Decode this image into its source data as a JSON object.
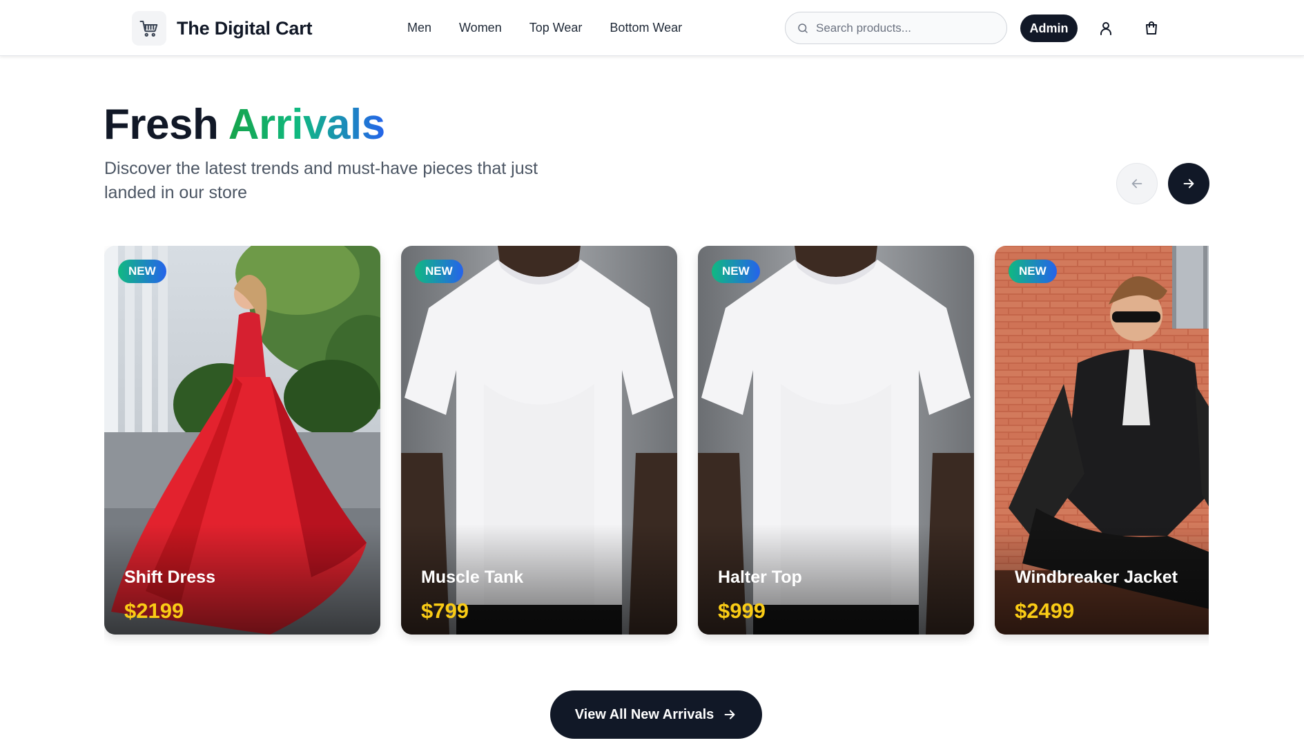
{
  "header": {
    "brand": "The Digital Cart",
    "brand_icon": "shopping-cart-icon",
    "nav": [
      "Men",
      "Women",
      "Top Wear",
      "Bottom Wear"
    ],
    "search_placeholder": "Search products...",
    "admin_label": "Admin",
    "icons": [
      "search-icon",
      "user-icon",
      "shopping-bag-icon"
    ]
  },
  "hero": {
    "title_part1": "Fresh",
    "title_part2": "Arrivals",
    "subtitle": "Discover the latest trends and must-have pieces that just landed in our store"
  },
  "carousel": {
    "prev_icon": "arrow-left-icon",
    "next_icon": "arrow-right-icon",
    "items": [
      {
        "badge": "NEW",
        "name": "Shift Dress",
        "price": "$2199"
      },
      {
        "badge": "NEW",
        "name": "Muscle Tank",
        "price": "$799"
      },
      {
        "badge": "NEW",
        "name": "Halter Top",
        "price": "$999"
      },
      {
        "badge": "NEW",
        "name": "Windbreaker Jacket",
        "price": "$2499"
      }
    ]
  },
  "cta": {
    "label": "View All New Arrivals",
    "icon": "arrow-right-icon"
  },
  "colors": {
    "dark": "#111827",
    "price": "#facc15",
    "accent_green": "#10b981",
    "accent_blue": "#2563eb"
  }
}
